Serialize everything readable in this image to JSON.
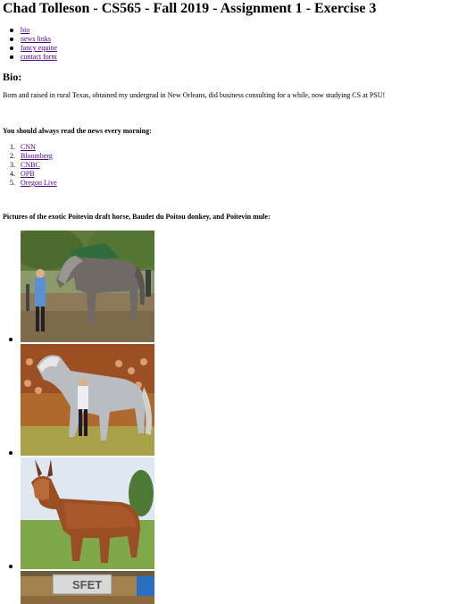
{
  "page": {
    "title": "Chad Tolleson - CS565 - Fall 2019 - Assignment 1 - Exercise 3"
  },
  "nav": {
    "items": [
      {
        "label": "bio"
      },
      {
        "label": "news links"
      },
      {
        "label": "fancy equine"
      },
      {
        "label": "contact form"
      }
    ]
  },
  "bio": {
    "heading": "Bio:",
    "text": "Born and raised in rural Texas, obtained my undergrad in New Orleans, did business consulting for a while, now studying CS at PSU!"
  },
  "news": {
    "heading": "You should always read the news every morning:",
    "links": [
      {
        "number": "1.",
        "label": "CNN"
      },
      {
        "number": "2.",
        "label": "Bloomberg"
      },
      {
        "number": "3.",
        "label": "CNBC"
      },
      {
        "number": "4.",
        "label": "OPB"
      },
      {
        "number": "5.",
        "label": "Oregon Live"
      }
    ]
  },
  "pictures": {
    "heading": "Pictures of the exotic Poitevin draft horse, Baudet du Poitou donkey, and Poitevin mule:",
    "photo4_banner_text": "SFET"
  },
  "colors": {
    "link": "#4b0082",
    "text": "#000000",
    "background": "#ffffff"
  }
}
